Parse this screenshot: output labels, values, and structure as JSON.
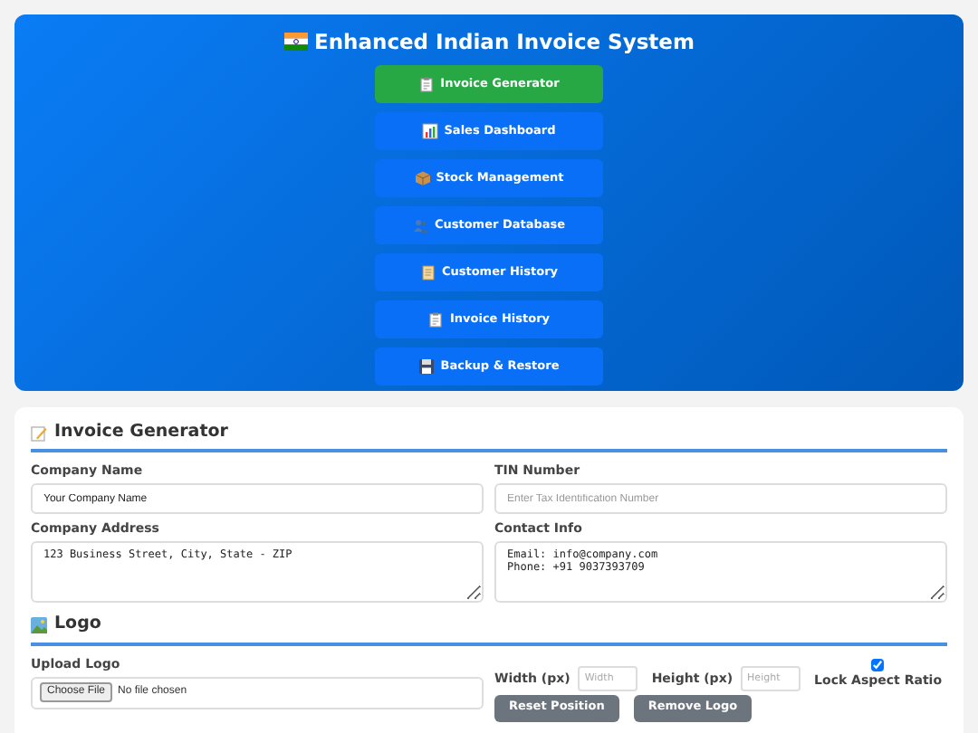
{
  "header": {
    "title": "Enhanced Indian Invoice System"
  },
  "nav": [
    {
      "label": "Invoice Generator",
      "selected": true
    },
    {
      "label": "Sales Dashboard",
      "selected": false
    },
    {
      "label": "Stock Management",
      "selected": false
    },
    {
      "label": "Customer Database",
      "selected": false
    },
    {
      "label": "Customer History",
      "selected": false
    },
    {
      "label": "Invoice History",
      "selected": false
    },
    {
      "label": "Backup & Restore",
      "selected": false
    }
  ],
  "section": {
    "title": "Invoice Generator",
    "fields": [
      {
        "label": "Company Name",
        "kind": "input",
        "value": "Your Company Name"
      },
      {
        "label": "TIN Number",
        "kind": "input",
        "placeholder": "Enter Tax Identification Number"
      },
      {
        "label": "Company Address",
        "kind": "textarea",
        "value": "123 Business Street, City, State - ZIP"
      },
      {
        "label": "Contact Info",
        "kind": "textarea",
        "value": "Email: info@company.com\nPhone: +91 9037393709"
      }
    ]
  },
  "logo": {
    "title": "Logo",
    "upload_label": "Upload Logo",
    "file_button": "Choose File",
    "file_status": "No file chosen",
    "width_label": "Width (px)",
    "width_placeholder": "Width",
    "height_label": "Height (px)",
    "height_placeholder": "Height",
    "lock_label": "Lock Aspect Ratio",
    "lock_checked": true,
    "buttons": [
      "Reset Position",
      "Remove Logo"
    ]
  }
}
